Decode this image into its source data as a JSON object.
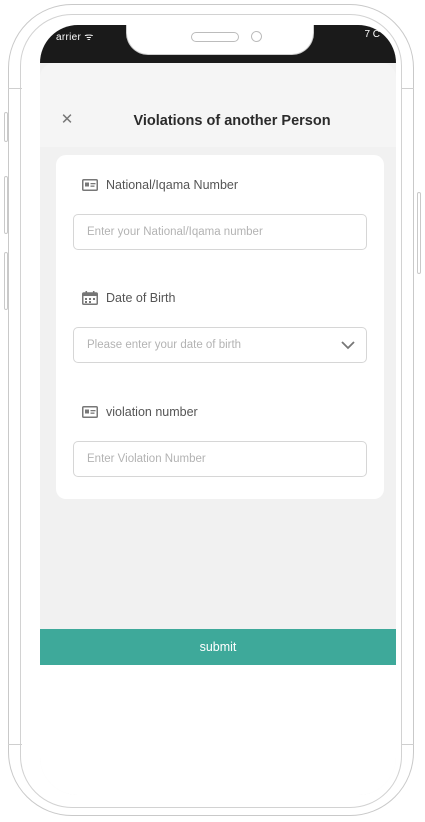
{
  "status_bar": {
    "left_text": "arrier ᯤ",
    "right_text": "7 C"
  },
  "header": {
    "title": "Violations of another Person",
    "close_icon": "close-icon"
  },
  "form": {
    "fields": [
      {
        "label": "National/Iqama Number",
        "placeholder": "Enter your National/Iqama number",
        "icon": "id-card-icon"
      },
      {
        "label": "Date of Birth",
        "placeholder": "Please enter your date of birth",
        "icon": "calendar-icon",
        "has_dropdown": true
      },
      {
        "label": "violation number",
        "placeholder": "Enter Violation Number",
        "icon": "id-card-icon"
      }
    ]
  },
  "submit_label": "submit",
  "colors": {
    "accent": "#3ea99a",
    "sheet_bg": "#f1f1f1",
    "card_bg": "#ffffff"
  }
}
